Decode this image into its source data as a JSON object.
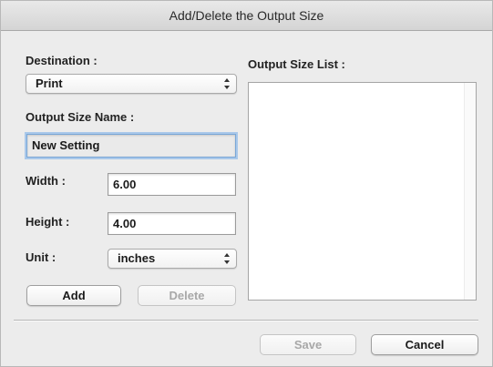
{
  "window": {
    "title": "Add/Delete the Output Size"
  },
  "destination": {
    "label": "Destination :",
    "selected": "Print"
  },
  "output_size_name": {
    "label": "Output Size Name :",
    "value": "New Setting"
  },
  "width": {
    "label": "Width :",
    "value": "6.00"
  },
  "height": {
    "label": "Height :",
    "value": "4.00"
  },
  "unit": {
    "label": "Unit :",
    "selected": "inches"
  },
  "output_size_list": {
    "label": "Output Size List :",
    "items": []
  },
  "buttons": {
    "add": "Add",
    "delete": "Delete",
    "save": "Save",
    "cancel": "Cancel"
  }
}
